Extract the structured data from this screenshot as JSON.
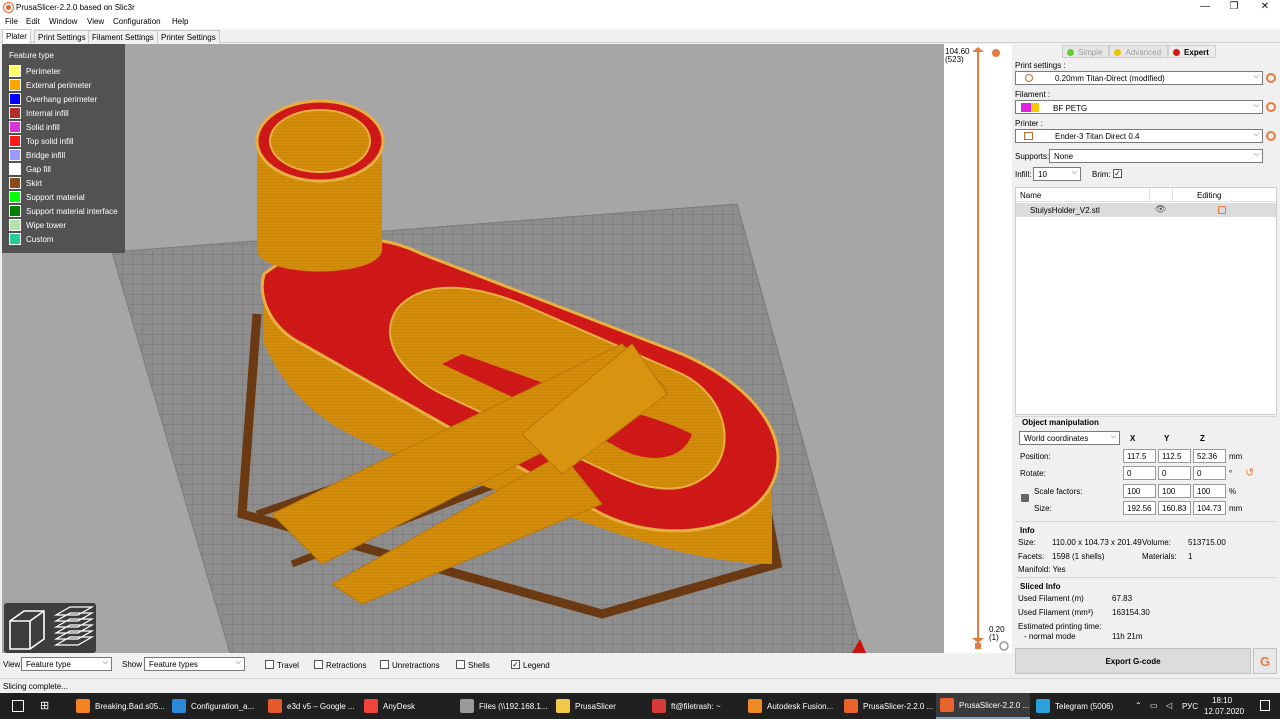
{
  "window": {
    "title": "PrusaSlicer-2.2.0 based on Slic3r",
    "minimize": "—",
    "maximize": "❐",
    "close": "✕"
  },
  "menu": [
    "File",
    "Edit",
    "Window",
    "View",
    "Configuration",
    "Help"
  ],
  "tabs": [
    "Plater",
    "Print Settings",
    "Filament Settings",
    "Printer Settings"
  ],
  "legend": {
    "title": "Feature type",
    "items": [
      {
        "label": "Perimeter",
        "color": "#ffff66"
      },
      {
        "label": "External perimeter",
        "color": "#ffa500"
      },
      {
        "label": "Overhang perimeter",
        "color": "#0000ff"
      },
      {
        "label": "Internal infill",
        "color": "#b03029"
      },
      {
        "label": "Solid infill",
        "color": "#d733d7"
      },
      {
        "label": "Top solid infill",
        "color": "#ff1a1a"
      },
      {
        "label": "Bridge infill",
        "color": "#9999ff"
      },
      {
        "label": "Gap fill",
        "color": "#ffffff"
      },
      {
        "label": "Skirt",
        "color": "#8a4a1a"
      },
      {
        "label": "Support material",
        "color": "#00ff00"
      },
      {
        "label": "Support material interface",
        "color": "#008000"
      },
      {
        "label": "Wipe tower",
        "color": "#b3e3ab"
      },
      {
        "label": "Custom",
        "color": "#28cc94"
      }
    ]
  },
  "slider": {
    "top_value": "104.60",
    "top_layer": "(523)",
    "bottom_value": "0.20",
    "bottom_layer": "(1)"
  },
  "modes": [
    {
      "label": "Simple",
      "color": "#66cc33",
      "active": false
    },
    {
      "label": "Advanced",
      "color": "#f2c200",
      "active": false
    },
    {
      "label": "Expert",
      "color": "#d01a1a",
      "active": true
    }
  ],
  "settings": {
    "print_label": "Print settings :",
    "print_value": "0.20mm Titan-Direct (modified)",
    "filament_label": "Filament :",
    "filament_value": "BF PETG",
    "filament_color": "#e020e0",
    "printer_label": "Printer :",
    "printer_value": "Ender-3 Titan Direct 0.4",
    "supports_label": "Supports:",
    "supports_value": "None",
    "infill_label": "Infill:",
    "infill_value": "10",
    "brim_label": "Brim:",
    "brim_checked": "✓"
  },
  "object_list": {
    "col_name": "Name",
    "col_editing": "Editing",
    "rows": [
      {
        "name": "StulysHolder_V2.stl"
      }
    ]
  },
  "manipulation": {
    "title": "Object manipulation",
    "coords": "World coordinates",
    "axes": [
      "X",
      "Y",
      "Z"
    ],
    "position_label": "Position:",
    "position": [
      "117.5",
      "112.5",
      "52.36"
    ],
    "position_unit": "mm",
    "rotate_label": "Rotate:",
    "rotate": [
      "0",
      "0",
      "0"
    ],
    "rotate_unit": "°",
    "scale_label": "Scale factors:",
    "scale": [
      "100",
      "100",
      "100"
    ],
    "scale_unit": "%",
    "size_label": "Size:",
    "size": [
      "192.56",
      "160.83",
      "104.73"
    ],
    "size_unit": "mm"
  },
  "info": {
    "title": "Info",
    "size_label": "Size:",
    "size_value": "110.00 x 104.73 x 201.49",
    "volume_label": "Volume:",
    "volume_value": "513715.00",
    "facets_label": "Facets:",
    "facets_value": "1598 (1 shells)",
    "materials_label": "Materials:",
    "materials_value": "1",
    "manifold": "Manifold: Yes"
  },
  "sliced_info": {
    "title": "Sliced Info",
    "filament_m_label": "Used Filament (m)",
    "filament_m_value": "67.83",
    "filament_mm3_label": "Used Filament (mm³)",
    "filament_mm3_value": "163154.30",
    "time_label": "Estimated printing time:",
    "mode_label": "- normal mode",
    "mode_value": "11h 21m"
  },
  "export": {
    "label": "Export G-code",
    "g": "G"
  },
  "bottom": {
    "view_label": "View",
    "view_value": "Feature type",
    "show_label": "Show",
    "show_value": "Feature types",
    "checks": [
      {
        "label": "Travel",
        "checked": ""
      },
      {
        "label": "Retractions",
        "checked": ""
      },
      {
        "label": "Unretractions",
        "checked": ""
      },
      {
        "label": "Shells",
        "checked": ""
      },
      {
        "label": "Legend",
        "checked": "✓"
      }
    ]
  },
  "status": "Slicing complete...",
  "taskbar": {
    "apps": [
      {
        "label": "Breaking.Bad.s05...",
        "color": "#f58220"
      },
      {
        "label": "Configuration_a...",
        "color": "#2d8ad8"
      },
      {
        "label": "e3d v5 – Google ...",
        "color": "#e7582b"
      },
      {
        "label": "AnyDesk",
        "color": "#ef443b"
      },
      {
        "label": "Files (\\\\192.168.1...",
        "color": "#9a9a9a"
      },
      {
        "label": "PrusaSlicer",
        "color": "#f3c94a"
      },
      {
        "label": "ft@filetrash: ~",
        "color": "#d63a3a"
      },
      {
        "label": "Autodesk Fusion...",
        "color": "#f08a24"
      },
      {
        "label": "PrusaSlicer-2.2.0 ...",
        "color": "#e8642c"
      },
      {
        "label": "PrusaSlicer-2.2.0 ...",
        "color": "#e8642c"
      },
      {
        "label": "Telegram (5006)",
        "color": "#2aa1da"
      }
    ],
    "lang": "РУС",
    "time": "18:10",
    "date": "12.07.2020"
  }
}
